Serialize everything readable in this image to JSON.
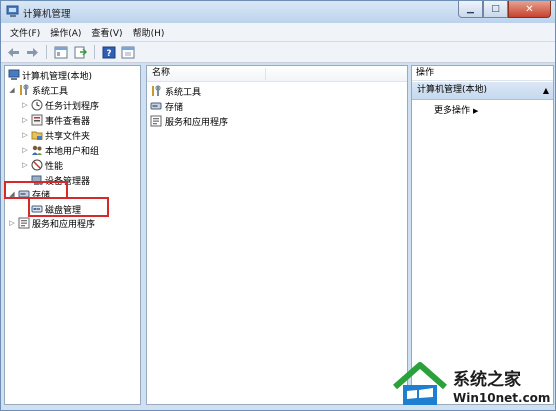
{
  "window": {
    "title": "计算机管理",
    "controls": {
      "minimize": "▁",
      "maximize": "□",
      "close": "✕"
    }
  },
  "menubar": [
    "文件(F)",
    "操作(A)",
    "查看(V)",
    "帮助(H)"
  ],
  "toolbar": [
    "back-arrow-icon",
    "forward-arrow-icon",
    "show-hide-tree-icon",
    "export-list-icon",
    "help-icon",
    "properties-icon"
  ],
  "tree": {
    "root": "计算机管理(本地)",
    "system_tools": "系统工具",
    "task_scheduler": "任务计划程序",
    "event_viewer": "事件查看器",
    "shared_folders": "共享文件夹",
    "local_users": "本地用户和组",
    "performance": "性能",
    "device_manager": "设备管理器",
    "storage": "存储",
    "disk_management": "磁盘管理",
    "services_apps": "服务和应用程序"
  },
  "main": {
    "column_header": "名称",
    "items": [
      "系统工具",
      "存储",
      "服务和应用程序"
    ]
  },
  "actions": {
    "title": "操作",
    "group": "计算机管理(本地)",
    "more": "更多操作"
  },
  "watermark": {
    "title": "系统之家",
    "url": "Win10net.com"
  },
  "colors": {
    "highlight": "#d6292a",
    "titlebar": "#bcd3ec",
    "actions_group": "#c6d9ee"
  }
}
